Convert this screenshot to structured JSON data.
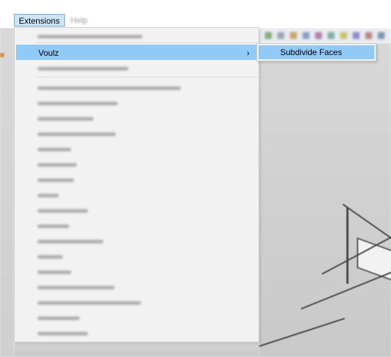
{
  "menubar": {
    "items": [
      {
        "label": "Extensions",
        "active": true
      },
      {
        "label": "Help",
        "active": false
      }
    ]
  },
  "extensions_menu": {
    "highlighted_item": {
      "label": "Voulz",
      "chevron": "›",
      "has_submenu": true
    },
    "blurred_item_count": 19
  },
  "submenu": {
    "items": [
      {
        "label": "Subdivide Faces",
        "highlighted": true
      }
    ]
  },
  "colors": {
    "menu_bg": "#f2f2f2",
    "highlight": "#91c9f7",
    "menubar_active_bg": "#cce4f7",
    "menubar_active_border": "#7aa6d6"
  }
}
